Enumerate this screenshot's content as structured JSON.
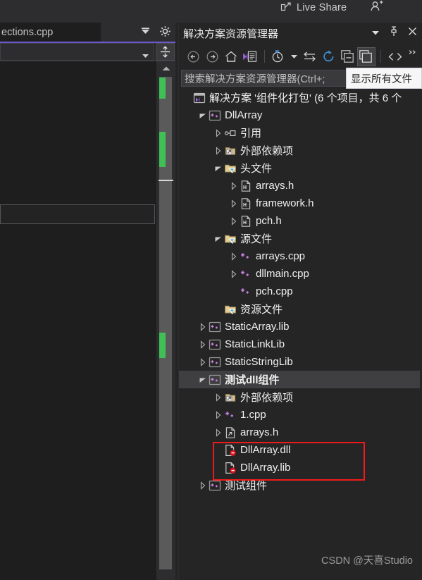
{
  "topbar": {
    "live_share_label": "Live Share",
    "share_icon": "share-screen-icon",
    "people_icon": "people-add-icon"
  },
  "editor_pane": {
    "tab_label": "ections.cpp",
    "tab_overflow_icon": "tab-overflow-icon",
    "settings_icon": "gear-icon",
    "navbar_dropdown_value": "",
    "navbar_caret_icon": "chevron-down-icon",
    "split_view_icon": "split-horizontal-icon",
    "scroll_up_icon": "scroll-up-arrow-icon",
    "change_markers_color": "#3fbf55"
  },
  "solution_explorer": {
    "title": "解决方案资源管理器",
    "title_buttons": [
      {
        "name": "window-dropdown-icon",
        "glyph": "▾"
      },
      {
        "name": "pin-icon",
        "glyph": "pin"
      },
      {
        "name": "close-icon",
        "glyph": "✕"
      }
    ],
    "toolbar": [
      {
        "name": "back-button",
        "icon": "arrow-left-circle-icon",
        "pressed": false
      },
      {
        "name": "forward-button",
        "icon": "arrow-right-circle-icon",
        "pressed": false
      },
      {
        "name": "home-button",
        "icon": "home-icon",
        "pressed": false
      },
      {
        "name": "solution-explorer-view-button",
        "icon": "vs-solution-icon",
        "pressed": false
      },
      {
        "name": "pending-changes-button",
        "icon": "clock-filter-icon",
        "pressed": false
      },
      {
        "name": "pending-changes-dropdown",
        "icon": "chevron-down-icon",
        "pressed": false
      },
      {
        "name": "sync-with-active-document-button",
        "icon": "sync-arrows-icon",
        "pressed": false
      },
      {
        "name": "refresh-button",
        "icon": "refresh-icon",
        "pressed": false
      },
      {
        "name": "collapse-all-button",
        "icon": "collapse-all-icon",
        "pressed": false
      },
      {
        "name": "show-all-files-button",
        "icon": "show-all-files-icon",
        "pressed": true
      },
      {
        "name": "view-code-button",
        "icon": "code-angle-brackets-icon",
        "pressed": false
      },
      {
        "name": "toolbar-overflow-button",
        "icon": "overflow-chevrons-icon",
        "pressed": false
      }
    ],
    "search_placeholder": "搜索解决方案资源管理器(Ctrl+;",
    "tooltip": "显示所有文件",
    "watermark": "CSDN @天喜Studio",
    "tree": [
      {
        "indent": 0,
        "chevron": "none",
        "icon": "solution-icon",
        "label": "解决方案 '组件化打包' (6 个项目，共 6 个",
        "selected": false,
        "bold": false
      },
      {
        "indent": 1,
        "chevron": "expanded",
        "icon": "cpp-project-icon",
        "label": "DllArray",
        "selected": false,
        "bold": false
      },
      {
        "indent": 2,
        "chevron": "collapsed",
        "icon": "references-icon",
        "label": "引用",
        "selected": false,
        "bold": false
      },
      {
        "indent": 2,
        "chevron": "collapsed",
        "icon": "external-deps-icon",
        "label": "外部依赖项",
        "selected": false,
        "bold": false
      },
      {
        "indent": 2,
        "chevron": "expanded",
        "icon": "filter-folder-icon",
        "label": "头文件",
        "selected": false,
        "bold": false
      },
      {
        "indent": 3,
        "chevron": "collapsed",
        "icon": "header-file-icon",
        "label": "arrays.h",
        "selected": false,
        "bold": false
      },
      {
        "indent": 3,
        "chevron": "collapsed",
        "icon": "header-file-icon",
        "label": "framework.h",
        "selected": false,
        "bold": false
      },
      {
        "indent": 3,
        "chevron": "collapsed",
        "icon": "header-file-icon",
        "label": "pch.h",
        "selected": false,
        "bold": false
      },
      {
        "indent": 2,
        "chevron": "expanded",
        "icon": "filter-folder-icon",
        "label": "源文件",
        "selected": false,
        "bold": false
      },
      {
        "indent": 3,
        "chevron": "collapsed",
        "icon": "cpp-file-icon",
        "label": "arrays.cpp",
        "selected": false,
        "bold": false
      },
      {
        "indent": 3,
        "chevron": "collapsed",
        "icon": "cpp-file-icon",
        "label": "dllmain.cpp",
        "selected": false,
        "bold": false
      },
      {
        "indent": 3,
        "chevron": "none",
        "icon": "cpp-file-icon",
        "label": "pch.cpp",
        "selected": false,
        "bold": false
      },
      {
        "indent": 2,
        "chevron": "none",
        "icon": "filter-folder-icon",
        "label": "资源文件",
        "selected": false,
        "bold": false
      },
      {
        "indent": 1,
        "chevron": "collapsed",
        "icon": "cpp-project-icon",
        "label": "StaticArray.lib",
        "selected": false,
        "bold": false
      },
      {
        "indent": 1,
        "chevron": "collapsed",
        "icon": "cpp-project-icon",
        "label": "StaticLinkLib",
        "selected": false,
        "bold": false
      },
      {
        "indent": 1,
        "chevron": "collapsed",
        "icon": "cpp-project-icon",
        "label": "StaticStringLib",
        "selected": false,
        "bold": false
      },
      {
        "indent": 1,
        "chevron": "expanded",
        "icon": "cpp-project-icon",
        "label": "测试dll组件",
        "selected": true,
        "bold": true
      },
      {
        "indent": 2,
        "chevron": "collapsed",
        "icon": "external-deps-icon",
        "label": "外部依赖项",
        "selected": false,
        "bold": false
      },
      {
        "indent": 2,
        "chevron": "collapsed",
        "icon": "cpp-file-icon",
        "label": "1.cpp",
        "selected": false,
        "bold": false
      },
      {
        "indent": 2,
        "chevron": "collapsed",
        "icon": "excluded-header-icon",
        "label": "arrays.h",
        "selected": false,
        "bold": false
      },
      {
        "indent": 2,
        "chevron": "none",
        "icon": "excluded-file-icon",
        "label": "DllArray.dll",
        "selected": false,
        "bold": false
      },
      {
        "indent": 2,
        "chevron": "none",
        "icon": "excluded-file-icon",
        "label": "DllArray.lib",
        "selected": false,
        "bold": false
      },
      {
        "indent": 1,
        "chevron": "collapsed",
        "icon": "cpp-project-icon",
        "label": "测试组件",
        "selected": false,
        "bold": false
      }
    ],
    "highlight_box_color": "#ef1b1b"
  }
}
